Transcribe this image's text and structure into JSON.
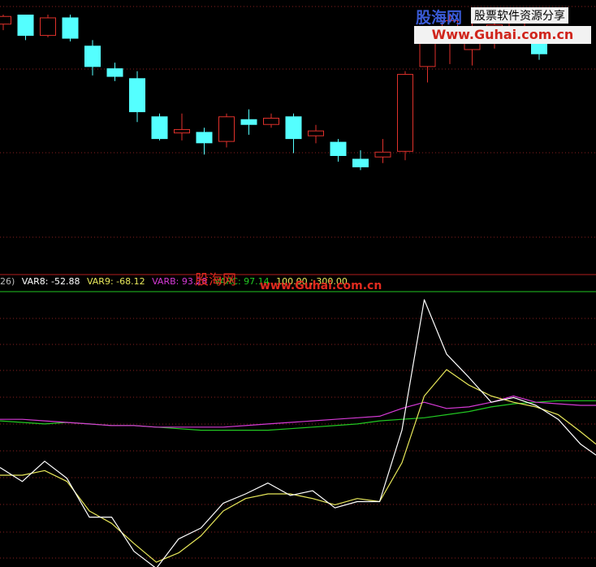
{
  "colors": {
    "background": "#000000",
    "up_candle": "#e0312b",
    "down_candle": "#54ffff",
    "grid": "#8a1f1f",
    "divider": "#b21c1c",
    "reference_line": "#1fc61f",
    "white_line": "#ffffff",
    "yellow_line": "#e8e85a",
    "magenta_line": "#d63ad6",
    "green_line": "#22c922"
  },
  "legend": {
    "prefix": "26)",
    "var8": "VAR8: -52.88",
    "var9": "VAR9: -68.12",
    "varb": "VARB: 93.28",
    "varc": "VARC: 97.14",
    "end_values": "100.00 ; 300.00"
  },
  "watermark": {
    "brand": "股海网",
    "tagline": "股票软件资源分享",
    "url": "Www.Guhai.com.cn",
    "mid_brand": "股海网",
    "mid_url": "www.Guhai.com.cn"
  },
  "chart_data": [
    {
      "type": "candlestick",
      "ylim": [
        0,
        100
      ],
      "candles": [
        {
          "open": 93,
          "close": 99,
          "high": 100,
          "low": 89,
          "dir": "up"
        },
        {
          "open": 100,
          "close": 85,
          "high": 100,
          "low": 82,
          "dir": "down"
        },
        {
          "open": 85,
          "close": 98,
          "high": 100,
          "low": 84,
          "dir": "up"
        },
        {
          "open": 98,
          "close": 83,
          "high": 100,
          "low": 81,
          "dir": "down"
        },
        {
          "open": 78,
          "close": 63,
          "high": 82,
          "low": 57,
          "dir": "down"
        },
        {
          "open": 62,
          "close": 56,
          "high": 66,
          "low": 53,
          "dir": "down"
        },
        {
          "open": 55,
          "close": 31,
          "high": 60,
          "low": 24,
          "dir": "down"
        },
        {
          "open": 28,
          "close": 12,
          "high": 30,
          "low": 11,
          "dir": "down"
        },
        {
          "open": 16,
          "close": 19,
          "high": 30,
          "low": 11,
          "dir": "up"
        },
        {
          "open": 17,
          "close": 9,
          "high": 20,
          "low": 1,
          "dir": "down"
        },
        {
          "open": 10,
          "close": 28,
          "high": 30,
          "low": 6,
          "dir": "up"
        },
        {
          "open": 26,
          "close": 22,
          "high": 33,
          "low": 15,
          "dir": "down"
        },
        {
          "open": 22,
          "close": 27,
          "high": 30,
          "low": 20,
          "dir": "up"
        },
        {
          "open": 28,
          "close": 12,
          "high": 30,
          "low": 2,
          "dir": "down"
        },
        {
          "open": 14,
          "close": 18,
          "high": 22,
          "low": 9,
          "dir": "up"
        },
        {
          "open": 10,
          "close": 0,
          "high": 12,
          "low": -4,
          "dir": "down"
        },
        {
          "open": -2,
          "close": -8,
          "high": 4,
          "low": -10,
          "dir": "down"
        },
        {
          "open": -1,
          "close": 3,
          "high": 12,
          "low": -5,
          "dir": "up"
        },
        {
          "open": 3,
          "close": 58,
          "high": 60,
          "low": -3,
          "dir": "up"
        },
        {
          "open": 63,
          "close": 82,
          "high": 89,
          "low": 52,
          "dir": "up"
        },
        {
          "open": 82,
          "close": 96,
          "high": 100,
          "low": 65,
          "dir": "up"
        },
        {
          "open": 75,
          "close": 88,
          "high": 100,
          "low": 64,
          "dir": "up"
        },
        {
          "open": 85,
          "close": 93,
          "high": 100,
          "low": 76,
          "dir": "up"
        },
        {
          "open": 85,
          "close": 100,
          "high": 100,
          "low": 82,
          "dir": "up"
        },
        {
          "open": 83,
          "close": 72,
          "high": 84,
          "low": 68,
          "dir": "down"
        }
      ]
    },
    {
      "type": "line",
      "ylim": [
        -70,
        100
      ],
      "x": [
        0,
        27.5,
        55,
        82.5,
        110,
        137.5,
        165,
        192.5,
        220,
        247.5,
        275,
        302.5,
        330,
        357.5,
        385,
        412.5,
        440,
        467.5,
        495,
        522.5,
        550,
        577.5,
        605,
        632.5,
        660,
        687.5,
        715,
        734
      ],
      "series": [
        {
          "name": "VAR8",
          "color": "#ffffff",
          "values": [
            -8,
            -17,
            -4,
            -15,
            -40,
            -40,
            -62,
            -73,
            -54,
            -47,
            -31,
            -25,
            -18,
            -26,
            -23,
            -34,
            -30,
            -30,
            16,
            100,
            65,
            50,
            34,
            37,
            32,
            23,
            7,
            0
          ]
        },
        {
          "name": "VAR9",
          "color": "#e8e85a",
          "values": [
            -13,
            -13,
            -10,
            -17,
            -36,
            -44,
            -57,
            -69,
            -63,
            -52,
            -36,
            -28,
            -25,
            -25,
            -28,
            -32,
            -28,
            -30,
            -5,
            38,
            55,
            45,
            38,
            34,
            31,
            26,
            15,
            7
          ]
        },
        {
          "name": "VARB",
          "color": "#d63ad6",
          "values": [
            23,
            23,
            22,
            21,
            20,
            19,
            19,
            18,
            18,
            18,
            18,
            19,
            20,
            21,
            22,
            23,
            24,
            25,
            30,
            34,
            30,
            31,
            34,
            38,
            34,
            33,
            32,
            32
          ]
        },
        {
          "name": "VARC",
          "color": "#22c922",
          "values": [
            22,
            21,
            20,
            21,
            20,
            19,
            19,
            18,
            17,
            16,
            16,
            16,
            16,
            17,
            18,
            19,
            20,
            22,
            23,
            24,
            26,
            28,
            31,
            33,
            34,
            35,
            35,
            35
          ]
        }
      ],
      "reference": [
        100,
        300
      ]
    }
  ]
}
